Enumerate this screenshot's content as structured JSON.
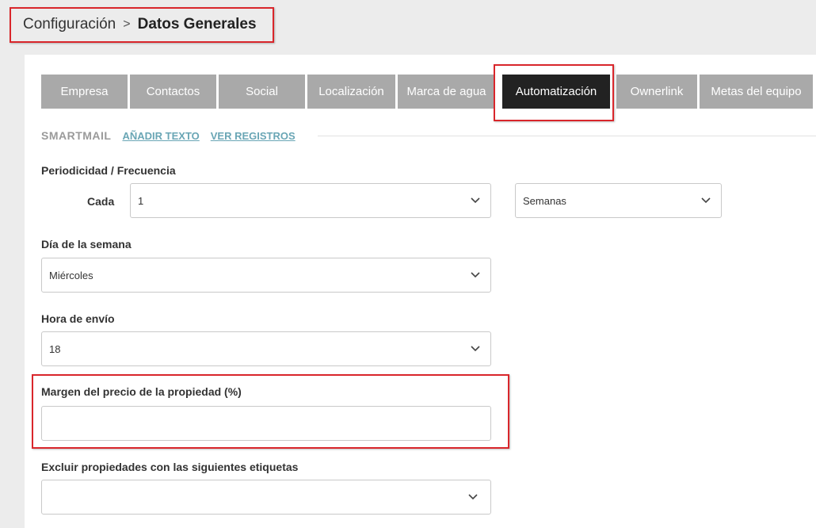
{
  "breadcrumb": {
    "parent": "Configuración",
    "separator": ">",
    "current": "Datos Generales"
  },
  "tabs": [
    {
      "label": "Empresa",
      "active": false
    },
    {
      "label": "Contactos",
      "active": false
    },
    {
      "label": "Social",
      "active": false
    },
    {
      "label": "Localización",
      "active": false
    },
    {
      "label": "Marca de agua",
      "active": false
    },
    {
      "label": "Automatización",
      "active": true
    },
    {
      "label": "Ownerlink",
      "active": false
    },
    {
      "label": "Metas del equipo",
      "active": false
    }
  ],
  "subnav": {
    "title": "SMARTMAIL",
    "add_text_link": "AÑADIR TEXTO",
    "view_logs_link": "VER REGISTROS"
  },
  "form": {
    "frequency": {
      "label": "Periodicidad / Frecuencia",
      "every_label": "Cada",
      "every_value": "1",
      "unit_value": "Semanas"
    },
    "weekday": {
      "label": "Día de la semana",
      "value": "Miércoles"
    },
    "send_hour": {
      "label": "Hora de envío",
      "value": "18"
    },
    "price_margin": {
      "label": "Margen del precio de la propiedad (%)",
      "value": ""
    },
    "exclude_tags": {
      "label": "Excluir propiedades con las siguientes etiquetas",
      "value": ""
    }
  },
  "colors": {
    "highlight": "#d9262b",
    "tab_inactive": "#a9a9a9",
    "tab_active": "#222222",
    "link": "#6aa6b5"
  },
  "icons": {
    "breadcrumb_separator": "chevron-right-icon",
    "select_arrow": "chevron-down-icon"
  }
}
